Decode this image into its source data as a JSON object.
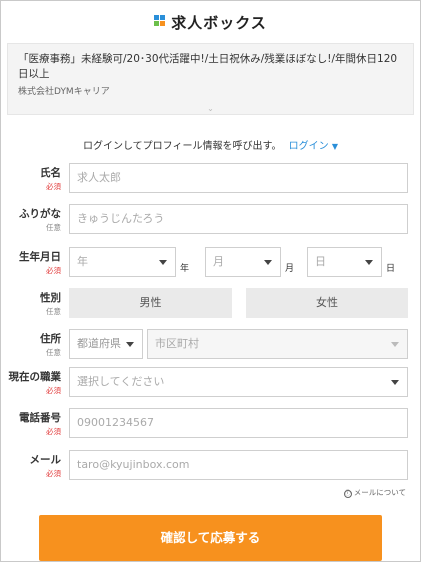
{
  "brand": {
    "name": "求人ボックス",
    "mark_colors": [
      "#2a8fd9",
      "#6cc04a",
      "#f7911e"
    ]
  },
  "job": {
    "title": "「医療事務」未経験可/20･30代活躍中!/土日祝休み/残業ほぼなし!/年間休日120日以上",
    "company": "株式会社DYMキャリア"
  },
  "login": {
    "prompt": "ログインしてプロフィール情報を呼び出す。",
    "link_label": "ログイン"
  },
  "labels": {
    "required": "必須",
    "optional": "任意"
  },
  "form": {
    "name": {
      "label": "氏名",
      "placeholder": "求人太郎"
    },
    "furigana": {
      "label": "ふりがな",
      "placeholder": "きゅうじんたろう"
    },
    "birthdate": {
      "label": "生年月日",
      "year_placeholder": "年",
      "year_unit": "年",
      "month_placeholder": "月",
      "month_unit": "月",
      "day_placeholder": "日",
      "day_unit": "日"
    },
    "gender": {
      "label": "性別",
      "male": "男性",
      "female": "女性"
    },
    "address": {
      "label": "住所",
      "prefecture_placeholder": "都道府県",
      "city_placeholder": "市区町村"
    },
    "occupation": {
      "label": "現在の職業",
      "placeholder": "選択してください"
    },
    "phone": {
      "label": "電話番号",
      "placeholder": "09001234567"
    },
    "email": {
      "label": "メール",
      "placeholder": "taro@kyujinbox.com",
      "note_icon": "ⓘ",
      "note": "メールについて"
    }
  },
  "submit": {
    "label": "確認して応募する"
  },
  "colors": {
    "accent": "#f7911e",
    "link": "#2a8fd9",
    "required": "#e23c3c"
  }
}
